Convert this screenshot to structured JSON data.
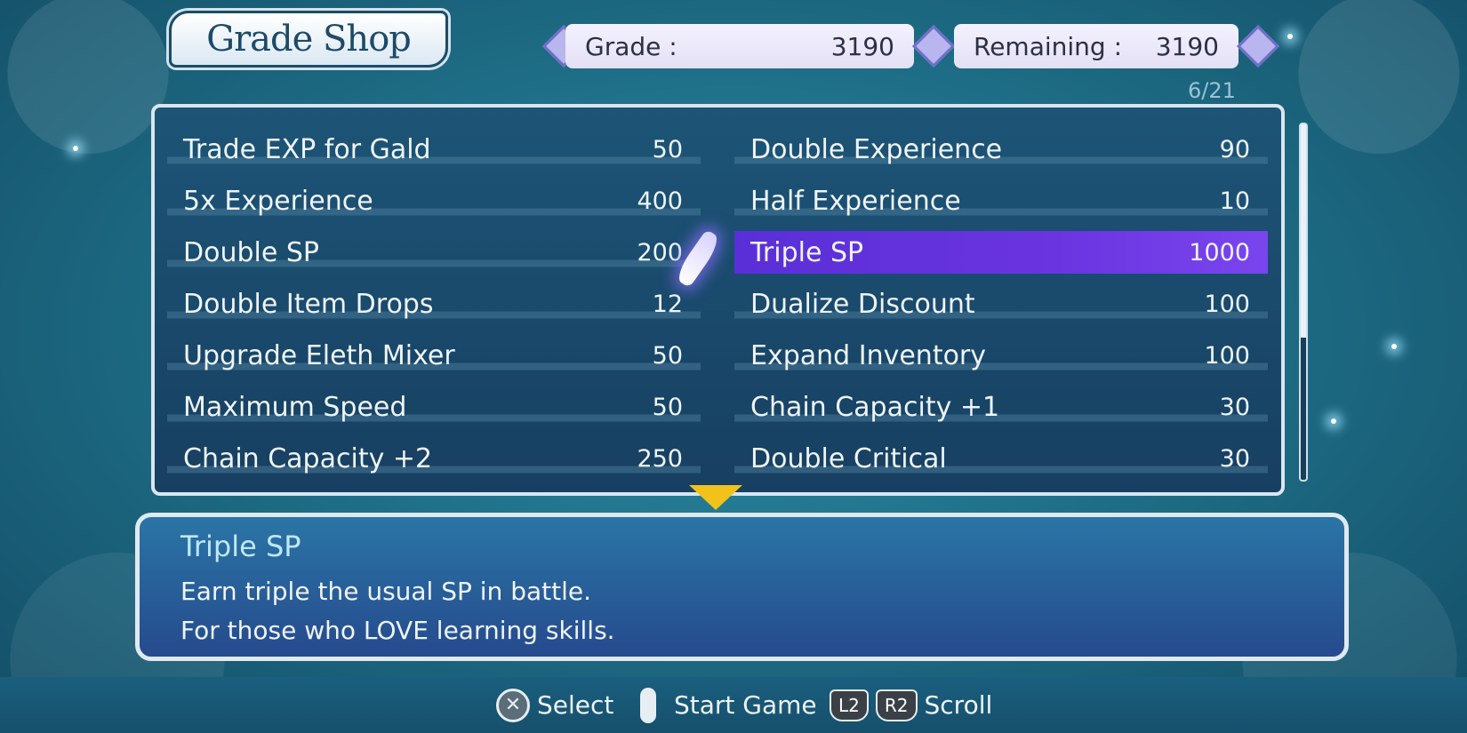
{
  "title": "Grade Shop",
  "grade": {
    "label": "Grade :",
    "value": "3190"
  },
  "remaining": {
    "label": "Remaining :",
    "value": "3190"
  },
  "page_counter": "6/21",
  "items": [
    {
      "name": "Trade EXP for Gald",
      "cost": "50"
    },
    {
      "name": "Double Experience",
      "cost": "90"
    },
    {
      "name": "5x Experience",
      "cost": "400"
    },
    {
      "name": "Half Experience",
      "cost": "10"
    },
    {
      "name": "Double SP",
      "cost": "200"
    },
    {
      "name": "Triple SP",
      "cost": "1000"
    },
    {
      "name": "Double Item Drops",
      "cost": "12"
    },
    {
      "name": "Dualize Discount",
      "cost": "100"
    },
    {
      "name": "Upgrade Eleth Mixer",
      "cost": "50"
    },
    {
      "name": "Expand Inventory",
      "cost": "100"
    },
    {
      "name": "Maximum Speed",
      "cost": "50"
    },
    {
      "name": "Chain Capacity +1",
      "cost": "30"
    },
    {
      "name": "Chain Capacity +2",
      "cost": "250"
    },
    {
      "name": "Double Critical",
      "cost": "30"
    }
  ],
  "selected_item_index": 5,
  "scroll_position": 0.6,
  "description": {
    "title": "Triple SP",
    "line1": "Earn triple the usual SP in battle.",
    "line2": "For those who LOVE learning skills."
  },
  "footer": {
    "select_button": "✕",
    "select_label": "Select",
    "start_label": "Start Game",
    "l2_label": "L2",
    "r2_label": "R2",
    "scroll_label": "Scroll"
  },
  "colors": {
    "selection": "#6a34e0",
    "panel": "#173f61",
    "accent_arrow": "#f2c21a"
  }
}
